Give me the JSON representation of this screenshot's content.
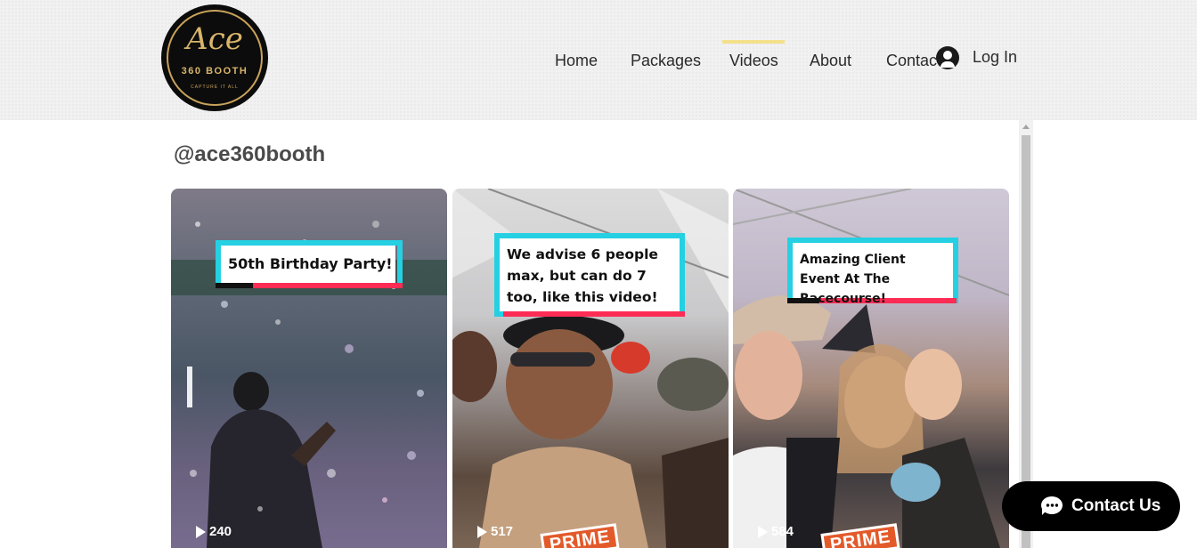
{
  "header": {
    "logo": {
      "script": "Ace",
      "brand": "360 BOOTH",
      "tagline": "CAPTURE IT ALL"
    },
    "nav": [
      {
        "label": "Home"
      },
      {
        "label": "Packages"
      },
      {
        "label": "Videos",
        "active": true
      },
      {
        "label": "About"
      },
      {
        "label": "Contact"
      }
    ],
    "login_label": "Log In"
  },
  "feed": {
    "handle": "@ace360booth",
    "videos": [
      {
        "caption": "50th Birthday Party!",
        "views": "240"
      },
      {
        "caption": "We advise 6 people max, but can do 7 too, like this video!",
        "views": "517",
        "overlay_tag": "PRIME"
      },
      {
        "caption": "Amazing Client Event At The Racecourse!",
        "views": "584",
        "overlay_tag": "PRIME"
      }
    ]
  },
  "chat": {
    "label": "Contact Us"
  },
  "colors": {
    "header_bg": "#f1f1f1",
    "nav_active_indicator": "#f4e08a",
    "caption_cyan": "#25d0e3",
    "caption_red": "#fe2c55",
    "logo_gold": "#d8b56a",
    "chat_bg": "#000000"
  }
}
